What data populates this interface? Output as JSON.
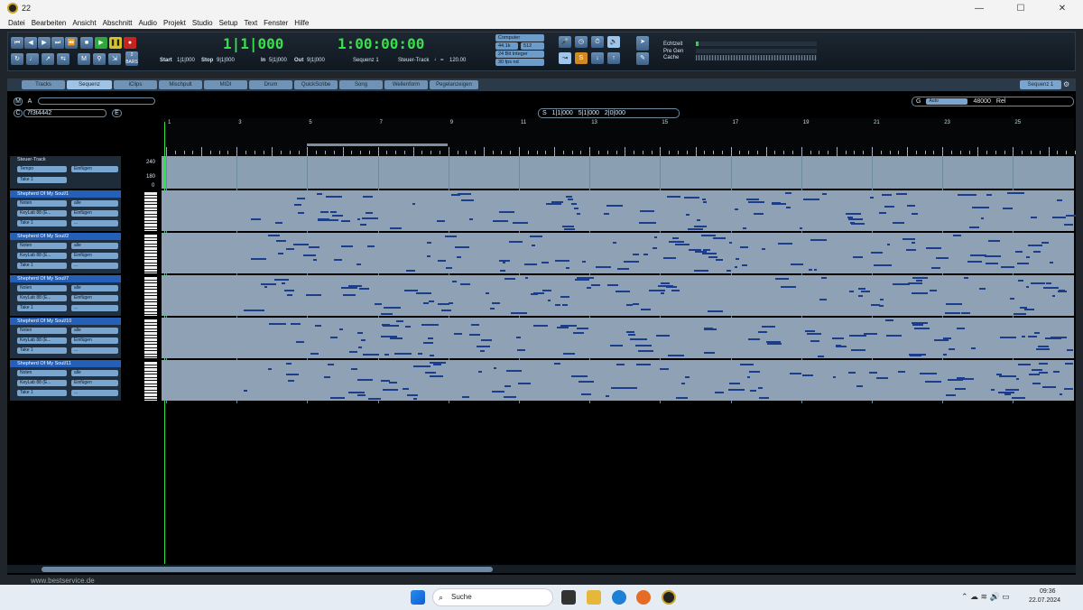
{
  "window": {
    "title": "22",
    "controls": [
      "—",
      "☐",
      "✕"
    ]
  },
  "menu": [
    "Datei",
    "Bearbeiten",
    "Ansicht",
    "Abschnitt",
    "Audio",
    "Projekt",
    "Studio",
    "Setup",
    "Text",
    "Fenster",
    "Hilfe"
  ],
  "transport": {
    "position_bars": "1|1|000",
    "position_time": "1:00:00:00",
    "start_label": "Start",
    "start_val": "1|1|000",
    "stop_label": "Stop",
    "stop_val": "9|1|000",
    "in_label": "In",
    "in_val": "5|1|000",
    "out_label": "Out",
    "out_val": "9|1|000",
    "sequence": "Sequenz 1",
    "steuer": "Steuer-Track",
    "tempo_eq": "=",
    "tempo": "120.00",
    "device": "Computer",
    "samplerate": "44.1k",
    "buffer": "512",
    "bitdepth": "24 Bit Integer",
    "fps": "30 fps nd",
    "meters": [
      "Echtzeit",
      "Pre Gen",
      "Cache"
    ],
    "bars_btn": "2 BARS"
  },
  "tabs": [
    "Tracks",
    "Sequenz",
    "iClips",
    "Mischpult",
    "MIDI",
    "Drum",
    "QuickScribe",
    "Song",
    "Wellenform",
    "Pegelanzeigen"
  ],
  "active_tab": "Sequenz",
  "seq_selector": "Sequenz 1",
  "chunk": "7f3t4442",
  "marker_btns": [
    "M",
    "A",
    "C",
    "E",
    "S",
    "G"
  ],
  "selection": {
    "start": "1|1|000",
    "end": "5|1|000",
    "length": "2|0|000",
    "mode": "Auto",
    "zoom": "48000",
    "rel": "Rel"
  },
  "bars": [
    "1",
    "3",
    "5",
    "7",
    "9",
    "11",
    "13",
    "15",
    "17",
    "19",
    "21",
    "23",
    "25"
  ],
  "steuer_track": {
    "name": "Steuer-Track",
    "field1": "Tempo",
    "field2": "Einfügen",
    "take": "Take 1",
    "scale": [
      "240",
      "180",
      "0"
    ]
  },
  "tracks": [
    {
      "name": "Shepherd Of My Soul/1",
      "type": "Noten",
      "filter": "alle",
      "device": "KeyLab 88 (E...",
      "mode": "Einfügen",
      "take": "Take 1",
      "extra": "..."
    },
    {
      "name": "Shepherd Of My Soul/2",
      "type": "Noten",
      "filter": "alle",
      "device": "KeyLab 88 (E...",
      "mode": "Einfügen",
      "take": "Take 1",
      "extra": "..."
    },
    {
      "name": "Shepherd Of My Soul/7",
      "type": "Noten",
      "filter": "alle",
      "device": "KeyLab 88 (E...",
      "mode": "Einfügen",
      "take": "Take 1",
      "extra": "..."
    },
    {
      "name": "Shepherd Of My Soul/10",
      "type": "Noten",
      "filter": "alle",
      "device": "KeyLab 88 (E...",
      "mode": "Einfügen",
      "take": "Take 1",
      "extra": "..."
    },
    {
      "name": "Shepherd Of My Soul/11",
      "type": "Noten",
      "filter": "alle",
      "device": "KeyLab 88 (E...",
      "mode": "Einfügen",
      "take": "Take 1",
      "extra": "..."
    }
  ],
  "watermark": "www.bestservice.de",
  "taskbar": {
    "search": "Suche",
    "time": "09:36",
    "date": "22.07.2024"
  },
  "colors": {
    "accent": "#38e04a",
    "track_name": "#2460b8",
    "lane": "#8fa2b5",
    "note": "#1c3d8c"
  }
}
